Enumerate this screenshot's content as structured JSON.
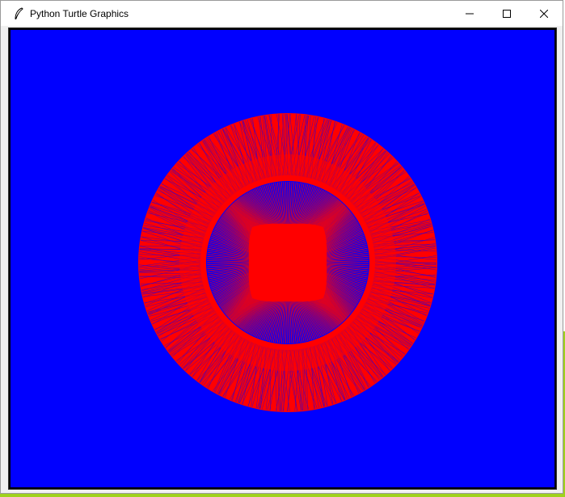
{
  "window": {
    "title": "Python Turtle Graphics",
    "controls": {
      "minimize": "minimize-icon",
      "maximize": "maximize-icon",
      "close": "close-icon"
    }
  },
  "canvas": {
    "background_color": "#0000ff",
    "pen_color": "#ff0000",
    "line_color": "#0000ff"
  }
}
